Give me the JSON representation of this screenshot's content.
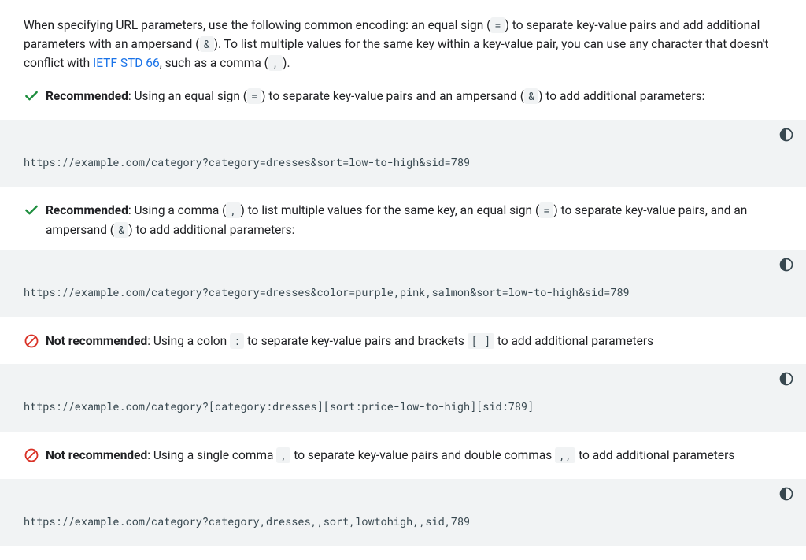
{
  "intro": {
    "part1": "When specifying URL parameters, use the following common encoding: an equal sign (",
    "code1": "=",
    "part2": ") to separate key-value pairs and add additional parameters with an ampersand (",
    "code2": "&",
    "part3": "). To list multiple values for the same key within a key-value pair, you can use any character that doesn't conflict with ",
    "link_text": "IETF STD 66",
    "part4": ", such as a comma (",
    "code3": ",",
    "part5": ")."
  },
  "sections": [
    {
      "label": "Recommended",
      "desc_pre": ": Using an equal sign (",
      "c1": "=",
      "desc_mid": ") to separate key-value pairs and an ampersand (",
      "c2": "&",
      "desc_post": ") to add additional parameters:",
      "code": "https://example.com/category?category=dresses&sort=low-to-high&sid=789"
    },
    {
      "label": "Recommended",
      "desc_pre": ": Using a comma (",
      "c1": ",",
      "desc_mid1": ") to list multiple values for the same key, an equal sign (",
      "c2": "=",
      "desc_mid2": ") to separate key-value pairs, and an ampersand (",
      "c3": "&",
      "desc_post": ") to add additional parameters:",
      "code": "https://example.com/category?category=dresses&color=purple,pink,salmon&sort=low-to-high&sid=789"
    },
    {
      "label": "Not recommended",
      "desc_pre": ": Using a colon ",
      "c1": ":",
      "desc_mid": " to separate key-value pairs and brackets ",
      "c2": "[ ]",
      "desc_post": " to add additional parameters",
      "code": "https://example.com/category?[category:dresses][sort:price-low-to-high][sid:789]"
    },
    {
      "label": "Not recommended",
      "desc_pre": ": Using a single comma ",
      "c1": ",",
      "desc_mid": " to separate key-value pairs and double commas ",
      "c2": ",,",
      "desc_post": " to add additional parameters",
      "code": "https://example.com/category?category,dresses,,sort,lowtohigh,,sid,789"
    }
  ]
}
